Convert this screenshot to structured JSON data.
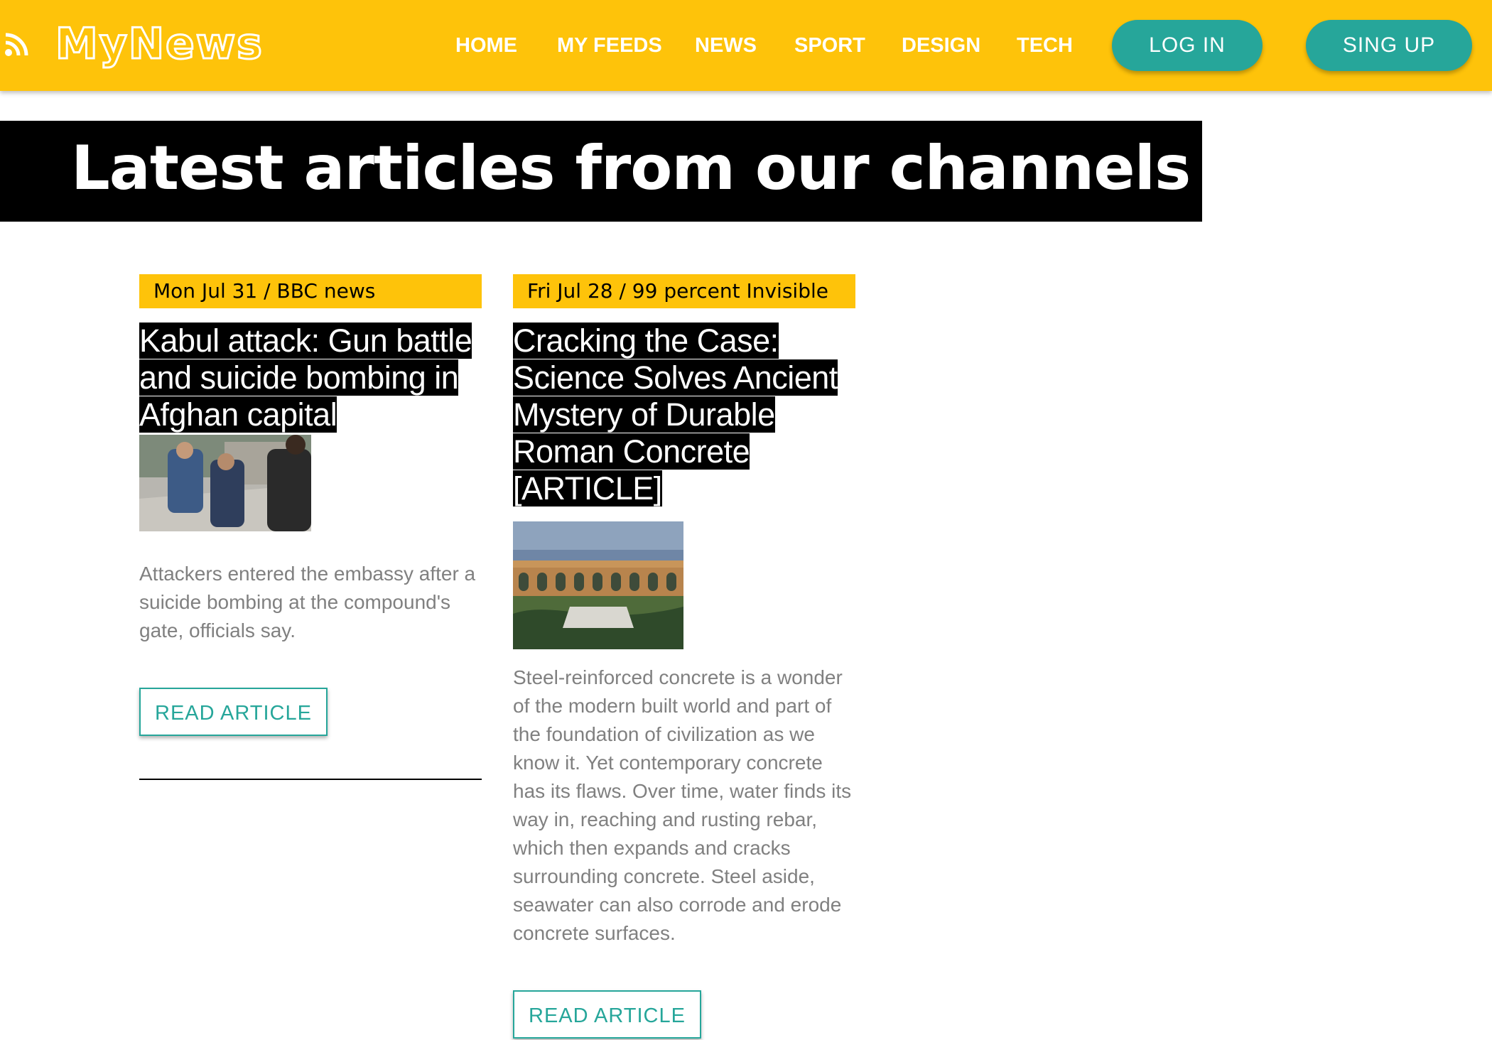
{
  "brand": {
    "logo_text": "MyNews",
    "color_primary": "#fec30a",
    "color_accent": "#26a69a",
    "rss_icon": "rss-icon"
  },
  "nav": {
    "items": [
      {
        "label": "HOME"
      },
      {
        "label": "MY FEEDS"
      },
      {
        "label": "NEWS"
      },
      {
        "label": "SPORT"
      },
      {
        "label": "DESIGN"
      },
      {
        "label": "TECH"
      }
    ],
    "login_label": "LOG IN",
    "signup_label": "SING UP"
  },
  "hero": {
    "title": "Latest articles from our channels"
  },
  "articles": [
    {
      "meta": "Mon Jul 31 / BBC news",
      "title": "Kabul attack: Gun battle and suicide bombing in Afghan capital",
      "summary": "Attackers entered the embassy after a suicide bombing at the compound's gate, officials say.",
      "button_label": "READ ARTICLE"
    },
    {
      "meta": "Fri Jul 28 / 99 percent Invisible",
      "title": "Cracking the Case: Science Solves Ancient Mystery of Durable Roman Concrete [ARTICLE]",
      "summary": "Steel-reinforced concrete is a wonder of the modern built world and part of the foundation of civilization as we know it. Yet contemporary concrete has its flaws. Over time, water finds its way in, reaching and rusting rebar, which then expands and cracks surrounding concrete. Steel aside, seawater can also corrode and erode concrete surfaces.",
      "button_label": "READ ARTICLE"
    }
  ]
}
